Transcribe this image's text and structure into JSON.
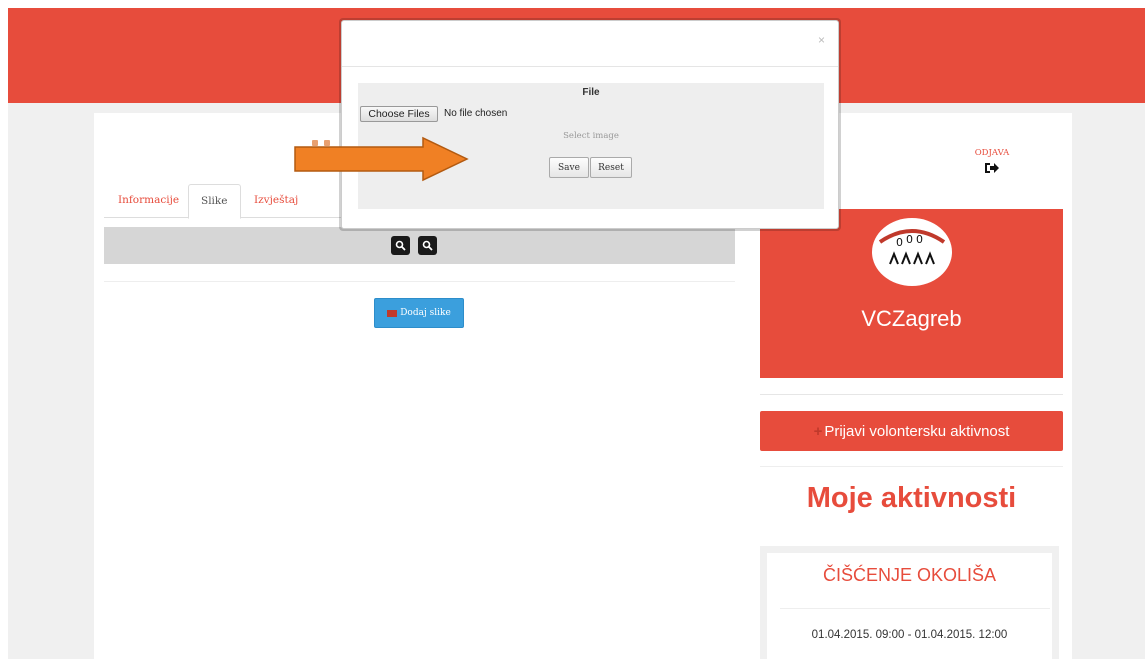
{
  "colors": {
    "accent": "#e74c3c",
    "button_blue": "#3b9fdd",
    "arrow": "#f08024"
  },
  "header": {
    "logout_label": "ODJAVA",
    "logout_icon": "sign-out-icon"
  },
  "tabs": [
    {
      "label": "Informacije",
      "active": false
    },
    {
      "label": "Slike",
      "active": true
    },
    {
      "label": "Izvještaj",
      "active": false
    }
  ],
  "gallery": {
    "zoom_icons": [
      "zoom-in-icon",
      "zoom-out-icon"
    ],
    "add_button_label": "Dodaj slike",
    "add_icon": "image-icon"
  },
  "sidebar": {
    "org_name": "VCZagreb",
    "report_button": "Prijavi volontersku aktivnost",
    "section_title": "Moje aktivnosti",
    "activity": {
      "name": "ČIŠĆENJE OKOLIŠA",
      "dates": "01.04.2015. 09:00 - 01.04.2015. 12:00"
    }
  },
  "modal": {
    "close": "×",
    "title": "File",
    "choose_button": "Choose Files",
    "no_file_text": "No file chosen",
    "hint": "Select image",
    "save_label": "Save",
    "reset_label": "Reset"
  }
}
